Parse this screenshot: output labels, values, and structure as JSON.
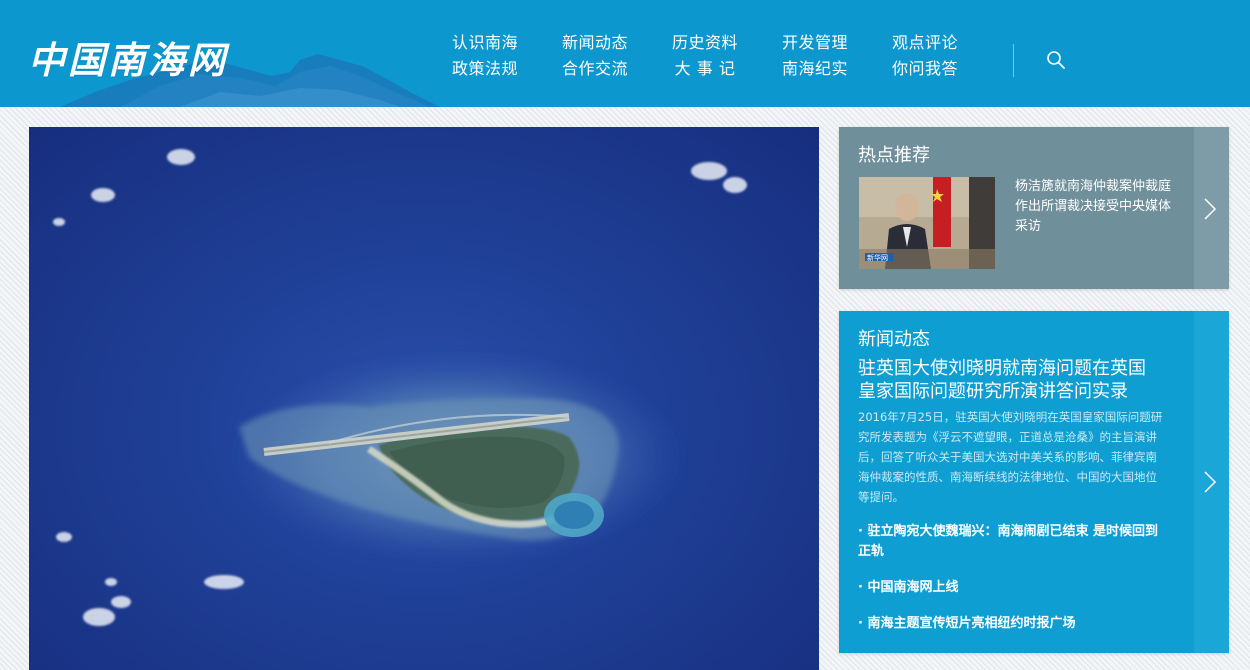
{
  "header": {
    "logo": "中国南海网",
    "nav": [
      {
        "top": "认识南海",
        "bottom": "政策法规"
      },
      {
        "top": "新闻动态",
        "bottom": "合作交流"
      },
      {
        "top": "历史资料",
        "bottom": "大 事 记"
      },
      {
        "top": "开发管理",
        "bottom": "南海纪实"
      },
      {
        "top": "观点评论",
        "bottom": "你问我答"
      }
    ],
    "search_icon": "search-icon"
  },
  "hot": {
    "title": "热点推荐",
    "item_text": "杨洁篪就南海仲裁案仲裁庭作出所谓裁决接受中央媒体采访",
    "thumb_watermark": "新华网"
  },
  "news": {
    "title": "新闻动态",
    "headline": "驻英国大使刘晓明就南海问题在英国皇家国际问题研究所演讲答问实录",
    "summary": "2016年7月25日，驻英国大使刘晓明在英国皇家国际问题研究所发表题为《浮云不遮望眼，正道总是沧桑》的主旨演讲后，回答了听众关于美国大选对中美关系的影响、菲律宾南海仲裁案的性质、南海断续线的法律地位、中国的大国地位等提问。",
    "links": [
      "· 驻立陶宛大使魏瑞兴：南海闹剧已结束 是时候回到正轨",
      "· 中国南海网上线",
      "· 南海主题宣传短片亮相纽约时报广场"
    ]
  },
  "colors": {
    "header_bg": "#0c98cf",
    "hot_panel": "#6f8f9b",
    "news_panel": "#0f9ed2",
    "sea": "#1f3f96"
  }
}
